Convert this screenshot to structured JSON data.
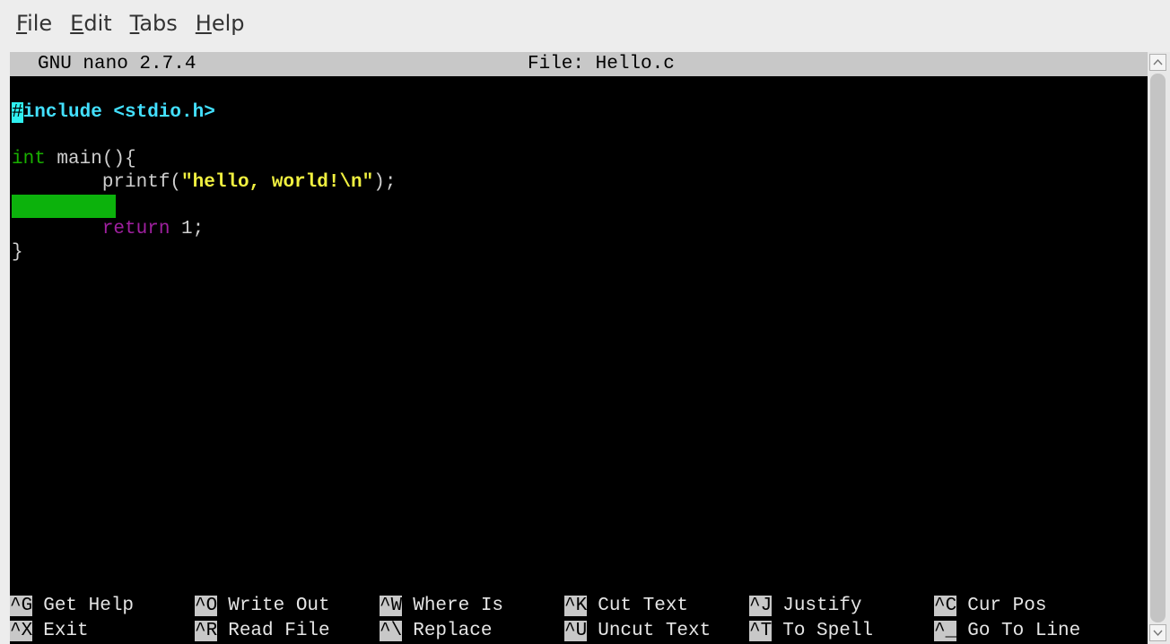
{
  "menu": {
    "items": [
      {
        "accel": "F",
        "rest": "ile"
      },
      {
        "accel": "E",
        "rest": "dit"
      },
      {
        "accel": "T",
        "rest": "abs"
      },
      {
        "accel": "H",
        "rest": "elp"
      }
    ]
  },
  "nano": {
    "version": "GNU nano 2.7.4",
    "file": "File: Hello.c"
  },
  "code": {
    "line1_cursor": "#",
    "line1_rest": "include <stdio.h>",
    "line3_type": "int",
    "line3_rest": " main(){",
    "line4_pre": "        printf(",
    "line4_str": "\"hello, world!\\n\"",
    "line4_post": ");",
    "line6_indent": "        ",
    "line6_kw": "return",
    "line6_rest": " 1;",
    "line7": "}"
  },
  "shortcuts": {
    "row1": [
      {
        "key": "^G",
        "label": "Get Help"
      },
      {
        "key": "^O",
        "label": "Write Out"
      },
      {
        "key": "^W",
        "label": "Where Is"
      },
      {
        "key": "^K",
        "label": "Cut Text"
      },
      {
        "key": "^J",
        "label": "Justify"
      },
      {
        "key": "^C",
        "label": "Cur Pos"
      }
    ],
    "row2": [
      {
        "key": "^X",
        "label": "Exit"
      },
      {
        "key": "^R",
        "label": "Read File"
      },
      {
        "key": "^\\",
        "label": "Replace"
      },
      {
        "key": "^U",
        "label": "Uncut Text"
      },
      {
        "key": "^T",
        "label": "To Spell"
      },
      {
        "key": "^_",
        "label": "Go To Line"
      }
    ]
  },
  "scrollbar": {
    "up_icon": "up-arrow-icon",
    "down_icon": "down-arrow-icon"
  }
}
